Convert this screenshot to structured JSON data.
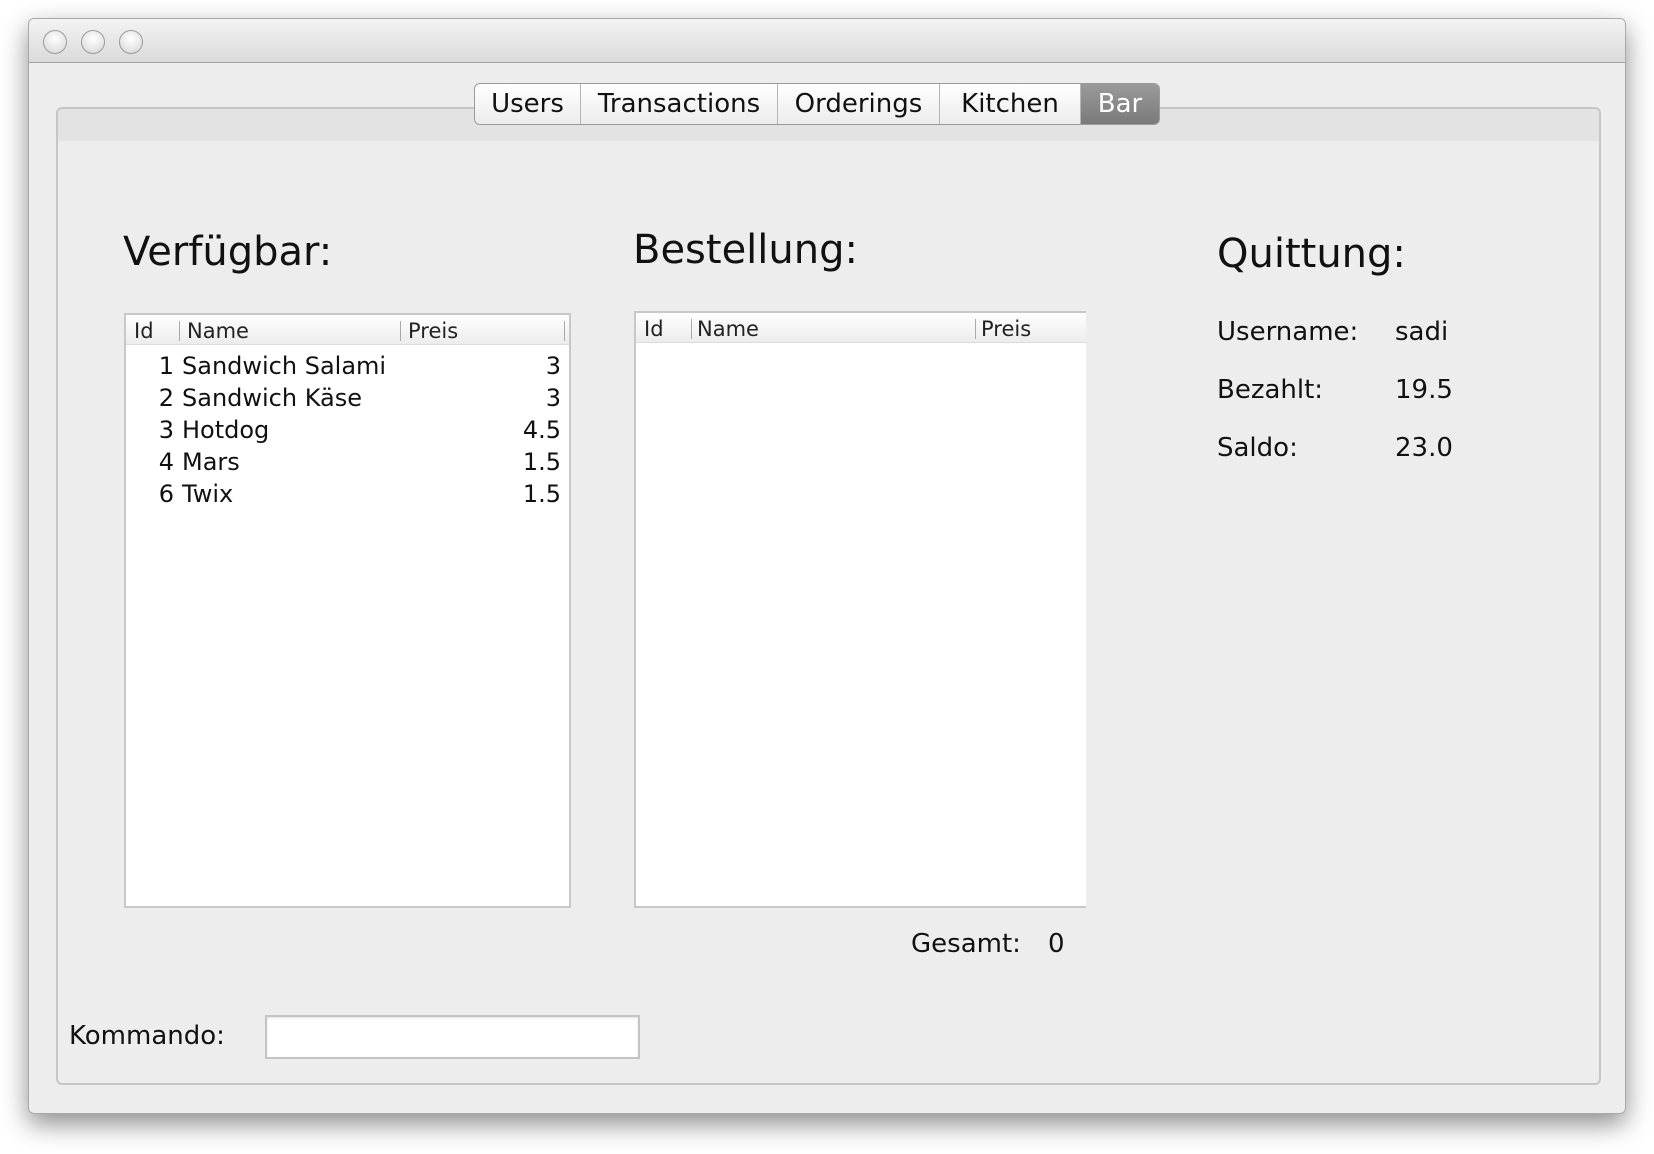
{
  "tabs": [
    "Users",
    "Transactions",
    "Orderings",
    "Kitchen",
    "Bar"
  ],
  "active_tab": "Bar",
  "available": {
    "title": "Verfügbar:",
    "columns": [
      "Id",
      "Name",
      "Preis"
    ],
    "rows": [
      {
        "id": "1",
        "name": "Sandwich Salami",
        "price": "3"
      },
      {
        "id": "2",
        "name": "Sandwich Käse",
        "price": "3"
      },
      {
        "id": "3",
        "name": "Hotdog",
        "price": "4.5"
      },
      {
        "id": "4",
        "name": "Mars",
        "price": "1.5"
      },
      {
        "id": "6",
        "name": "Twix",
        "price": "1.5"
      }
    ]
  },
  "order": {
    "title": "Bestellung:",
    "columns": [
      "Id",
      "Name",
      "Preis"
    ],
    "rows": [],
    "total_label": "Gesamt:",
    "total_value": "0"
  },
  "receipt": {
    "title": "Quittung:",
    "username_label": "Username:",
    "username_value": "sadi",
    "paid_label": "Bezahlt:",
    "paid_value": "19.5",
    "balance_label": "Saldo:",
    "balance_value": "23.0"
  },
  "command": {
    "label": "Kommando:",
    "value": ""
  }
}
